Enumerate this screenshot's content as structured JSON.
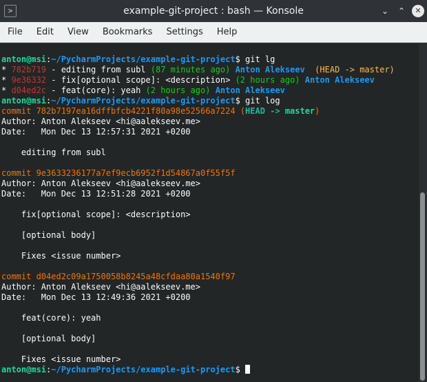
{
  "window": {
    "title": "example-git-project : bash — Konsole",
    "app_icon_glyph": ">",
    "minimize_glyph": "⌄",
    "maximize_glyph": "⌃",
    "close_glyph": "✕"
  },
  "menu": [
    "File",
    "Edit",
    "View",
    "Bookmarks",
    "Settings",
    "Help"
  ],
  "prompt": {
    "user_host": "anton@msi",
    "sep": ":",
    "path": "~/PycharmProjects/example-git-project",
    "symbol": "$"
  },
  "commands": {
    "lg": " git lg",
    "log": " git log"
  },
  "lg_entries": [
    {
      "bullet": "* ",
      "hash": "782b719",
      "msg": " - editing from subl ",
      "age": "(87 minutes ago)",
      "author": "Anton Alekseev",
      "refs": "  (HEAD -> master)"
    },
    {
      "bullet": "* ",
      "hash": "9e36332",
      "msg": " - fix[optional scope]: <description> ",
      "age": "(2 hours ago)",
      "author": "Anton Alekseev",
      "refs": ""
    },
    {
      "bullet": "* ",
      "hash": "d04ed2c",
      "msg": " - feat(core): yeah ",
      "age": "(2 hours ago)",
      "author": "Anton Alekseev",
      "refs": ""
    }
  ],
  "log": {
    "commit1": {
      "commit": "commit 782b7197ea16dffbfcb4221f80a98e52566a7224",
      "ref_open": " (",
      "ref_head": "HEAD -> ",
      "ref_branch": "master",
      "ref_close": ")",
      "author": "Author: Anton Alekseev <hi@aalekseev.me>",
      "date": "Date:   Mon Dec 13 12:57:31 2021 +0200",
      "body": [
        "    editing from subl"
      ]
    },
    "commit2": {
      "commit": "commit 9e3633236177a7ef9ecb6952f1d54867a0f55f5f",
      "author": "Author: Anton Alekseev <hi@aalekseev.me>",
      "date": "Date:   Mon Dec 13 12:51:28 2021 +0200",
      "body": [
        "    fix[optional scope]: <description>",
        "    [optional body]",
        "    Fixes <issue number>"
      ]
    },
    "commit3": {
      "commit": "commit d04ed2c09a1750058b8245a48cfdaa80a1540f97",
      "author": "Author: Anton Alekseev <hi@aalekseev.me>",
      "date": "Date:   Mon Dec 13 12:49:36 2021 +0200",
      "body": [
        "    feat(core): yeah",
        "    [optional body]",
        "    Fixes <issue number>"
      ]
    }
  },
  "colors": {
    "prompt_user": "#1cdc9a",
    "prompt_path": "#1d99f3",
    "commit_hash": "#f67400",
    "terminal_bg": "#232627"
  }
}
